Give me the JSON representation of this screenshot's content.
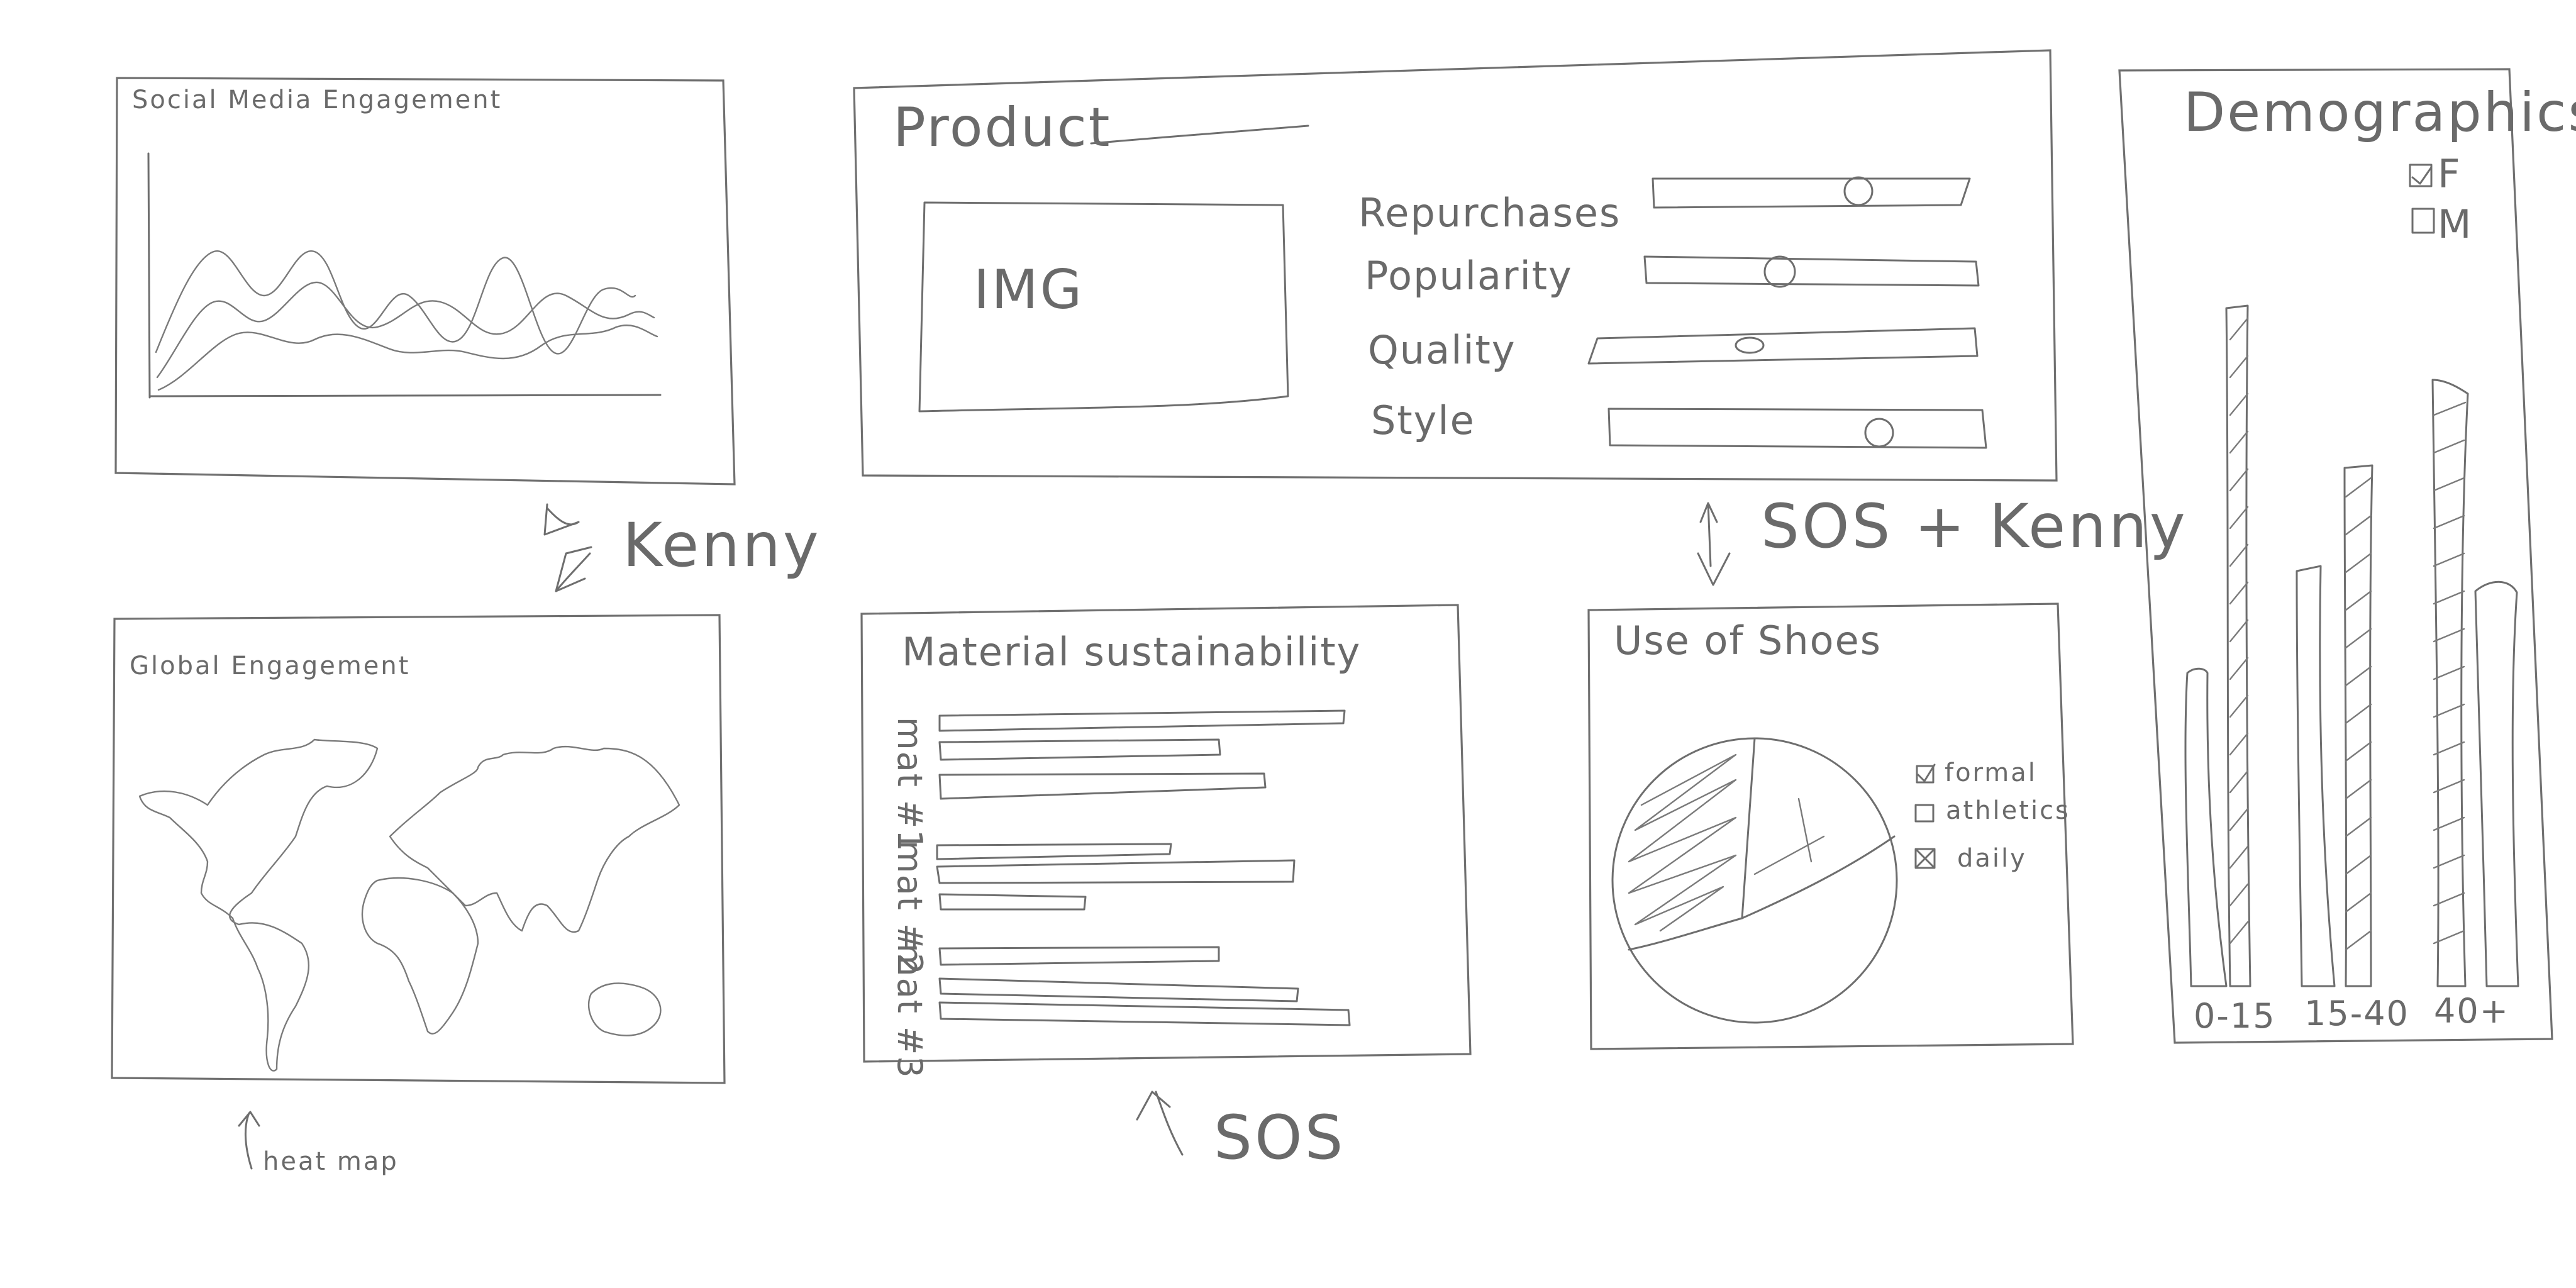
{
  "panels": {
    "social": {
      "title": "Social Media Engagement"
    },
    "product": {
      "title": "Product",
      "image_placeholder": "IMG",
      "sliders": [
        {
          "label": "Repurchases",
          "value": 0.55
        },
        {
          "label": "Popularity",
          "value": 0.41
        },
        {
          "label": "Quality",
          "value": 0.38
        },
        {
          "label": "Style",
          "value": 0.72
        }
      ]
    },
    "demographics": {
      "title": "Demographics",
      "legend": [
        {
          "label": "F",
          "checked": true
        },
        {
          "label": "M",
          "checked": false
        }
      ],
      "categories": [
        "0-15",
        "15-40",
        "40+"
      ]
    },
    "global": {
      "title": "Global Engagement"
    },
    "material": {
      "title": "Material sustainability",
      "groups": [
        "mat #1",
        "mat #2",
        "mat #3"
      ]
    },
    "shoes": {
      "title": "Use of Shoes",
      "legend": [
        {
          "label": "formal",
          "mark": "check"
        },
        {
          "label": "athletics",
          "mark": "empty"
        },
        {
          "label": "daily",
          "mark": "cross"
        }
      ]
    }
  },
  "annotations": {
    "kenny": "Kenny",
    "sos_kenny": "SOS + Kenny",
    "heat_map": "heat map",
    "sos": "SOS"
  }
}
